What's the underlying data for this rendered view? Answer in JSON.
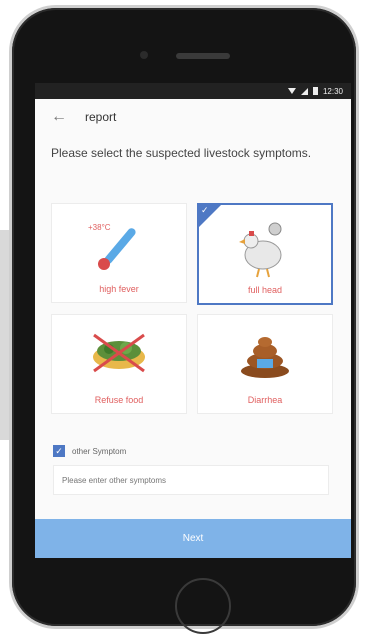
{
  "status_bar": {
    "time": "12:30",
    "icons": [
      "wifi-icon",
      "signal-icon",
      "battery-icon"
    ]
  },
  "header": {
    "back_icon": "arrow-left-icon",
    "title": "report"
  },
  "prompt": "Please select the suspected livestock symptoms.",
  "symptoms": [
    {
      "label": "high fever",
      "icon": "thermometer-icon",
      "selected": false,
      "annotation": "+38°C"
    },
    {
      "label": "full head",
      "icon": "chicken-icon",
      "selected": true
    },
    {
      "label": "Refuse food",
      "icon": "bowl-crossed-icon",
      "selected": false
    },
    {
      "label": "Diarrhea",
      "icon": "poop-icon",
      "selected": false
    }
  ],
  "other_symptom": {
    "label": "other Symptom",
    "checked": true,
    "placeholder": "Please enter other symptoms"
  },
  "next_button": {
    "label": "Next"
  },
  "colors": {
    "accent": "#4e78c4",
    "button": "#7fb3e8",
    "label_red": "#e06060"
  }
}
